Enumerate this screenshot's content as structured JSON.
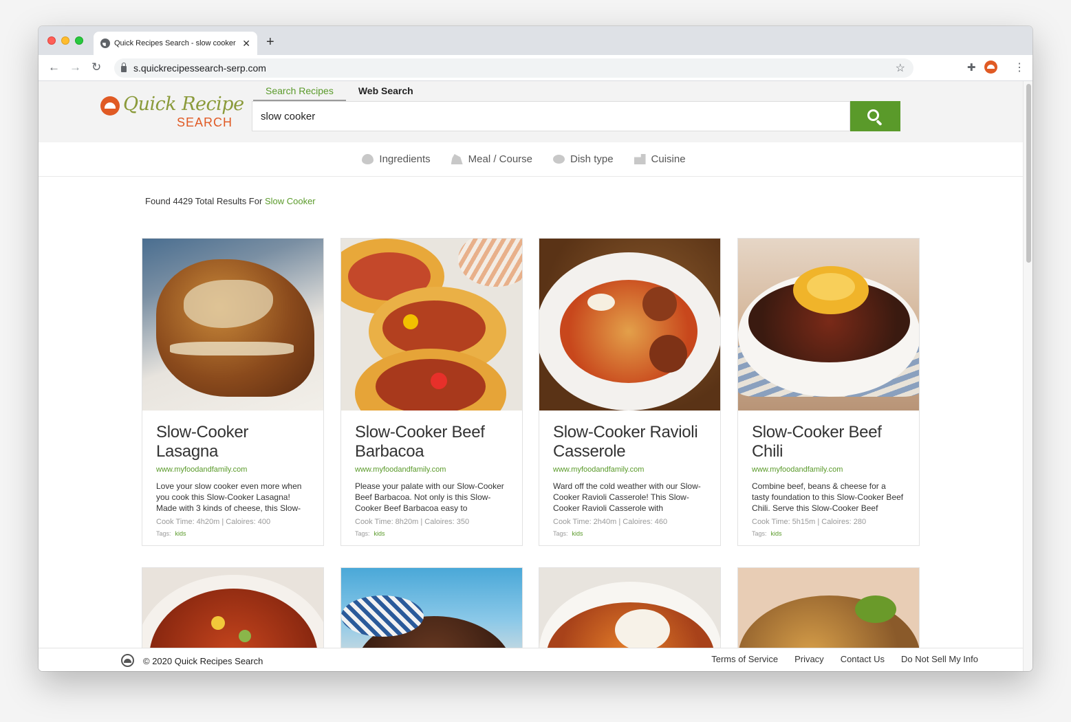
{
  "browser": {
    "tab_title": "Quick Recipes Search - slow cooker",
    "tab_close": "✕",
    "new_tab": "+",
    "url": "s.quickrecipessearch-serp.com",
    "back": "←",
    "forward": "→",
    "reload": "↻",
    "bookmark": "☆",
    "extensions": "✚",
    "menu": "⋮"
  },
  "header": {
    "logo_script": "Quick Recipe",
    "logo_word": "SEARCH",
    "tabs": [
      {
        "label": "Search Recipes",
        "active": true
      },
      {
        "label": "Web Search",
        "active": false
      }
    ],
    "search_value": "slow cooker"
  },
  "filters": [
    {
      "label": "Ingredients",
      "icon": "ingredients-icon"
    },
    {
      "label": "Meal / Course",
      "icon": "meal-course-icon"
    },
    {
      "label": "Dish type",
      "icon": "dish-type-icon"
    },
    {
      "label": "Cuisine",
      "icon": "cuisine-icon"
    }
  ],
  "results": {
    "prefix": "Found 4429 Total Results For",
    "query": "Slow Cooker"
  },
  "cards": [
    {
      "title": "Slow-Cooker Lasagna",
      "site": "www.myfoodandfamily.com",
      "desc": "Love your slow cooker even more when you cook this Slow-Cooker Lasagna! Made with 3 kinds of cheese, this Slow-",
      "meta": "Cook Time: 4h20m  |  Caloires: 400",
      "tags_label": "Tags:",
      "tag": "kids"
    },
    {
      "title": "Slow-Cooker Beef Barbacoa",
      "site": "www.myfoodandfamily.com",
      "desc": "Please your palate with our Slow-Cooker Beef Barbacoa. Not only is this Slow-Cooker Beef Barbacoa easy to",
      "meta": "Cook Time: 8h20m  |  Caloires: 350",
      "tags_label": "Tags:",
      "tag": "kids"
    },
    {
      "title": "Slow-Cooker Ravioli Casserole",
      "site": "www.myfoodandfamily.com",
      "desc": "Ward off the cold weather with our Slow-Cooker Ravioli Casserole! This Slow-Cooker Ravioli Casserole with",
      "meta": "Cook Time: 2h40m  |  Caloires: 460",
      "tags_label": "Tags:",
      "tag": "kids"
    },
    {
      "title": "Slow-Cooker Beef Chili",
      "site": "www.myfoodandfamily.com",
      "desc": "Combine beef, beans & cheese for a tasty foundation to this Slow-Cooker Beef Chili. Serve this Slow-Cooker Beef",
      "meta": "Cook Time: 5h15m  |  Caloires: 280",
      "tags_label": "Tags:",
      "tag": "kids"
    }
  ],
  "footer": {
    "copyright": "© 2020 Quick Recipes Search",
    "links": [
      "Terms of Service",
      "Privacy",
      "Contact Us",
      "Do Not Sell My Info"
    ]
  },
  "colors": {
    "brand_green": "#5a9a2a",
    "brand_orange": "#e05a24"
  }
}
